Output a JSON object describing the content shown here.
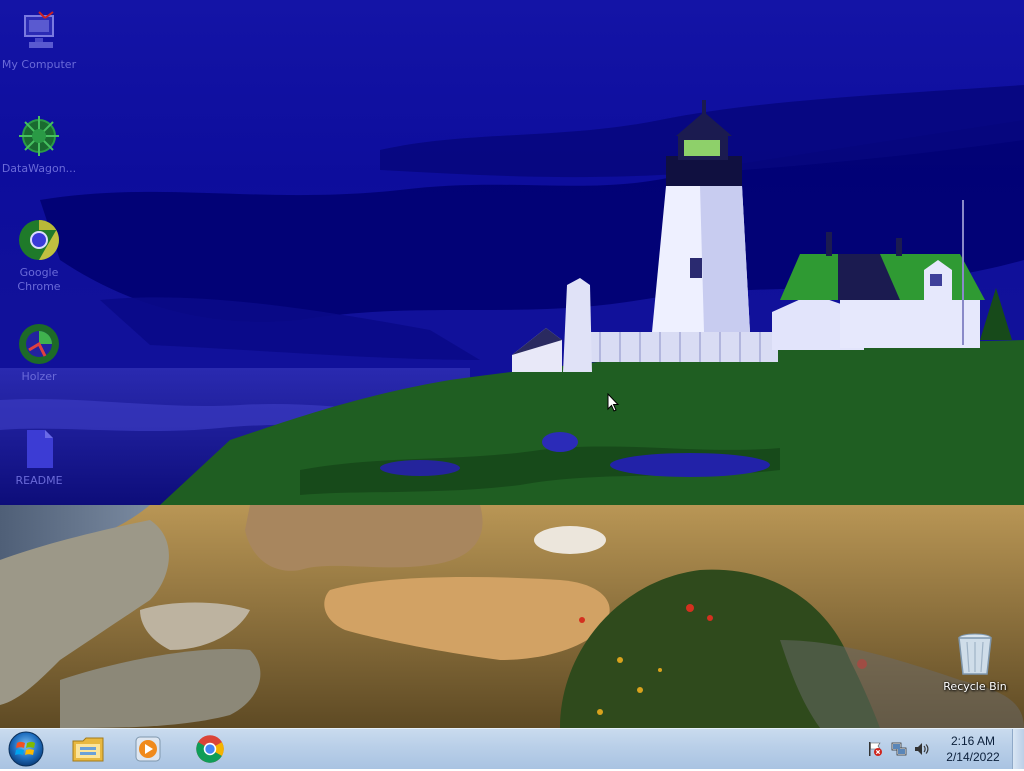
{
  "desktop": {
    "icons": [
      {
        "label": "My Computer",
        "icon": "computer-icon",
        "dim": true
      },
      {
        "label": "DataWagon...",
        "icon": "datawagon-icon",
        "dim": true
      },
      {
        "label": "Google Chrome",
        "icon": "chrome-icon",
        "dim": true
      },
      {
        "label": "Holzer",
        "icon": "holzer-icon",
        "dim": true
      },
      {
        "label": "README",
        "icon": "document-icon",
        "dim": true
      }
    ],
    "recycle_bin": {
      "label": "Recycle Bin",
      "icon": "recycle-bin-icon"
    }
  },
  "taskbar": {
    "start": {
      "icon": "windows-start-orb"
    },
    "pinned": [
      {
        "icon": "file-explorer-icon"
      },
      {
        "icon": "media-player-icon"
      },
      {
        "icon": "chrome-icon"
      }
    ],
    "tray": {
      "icons": [
        "action-center-flag-icon",
        "network-icon",
        "volume-icon"
      ],
      "time": "2:16 AM",
      "date": "2/14/2022"
    }
  },
  "colors": {
    "sky_top": "#1a1aa8",
    "sky_band": "#000080",
    "grass": "#1f5e22",
    "taskbar": "#b9cfe8"
  }
}
